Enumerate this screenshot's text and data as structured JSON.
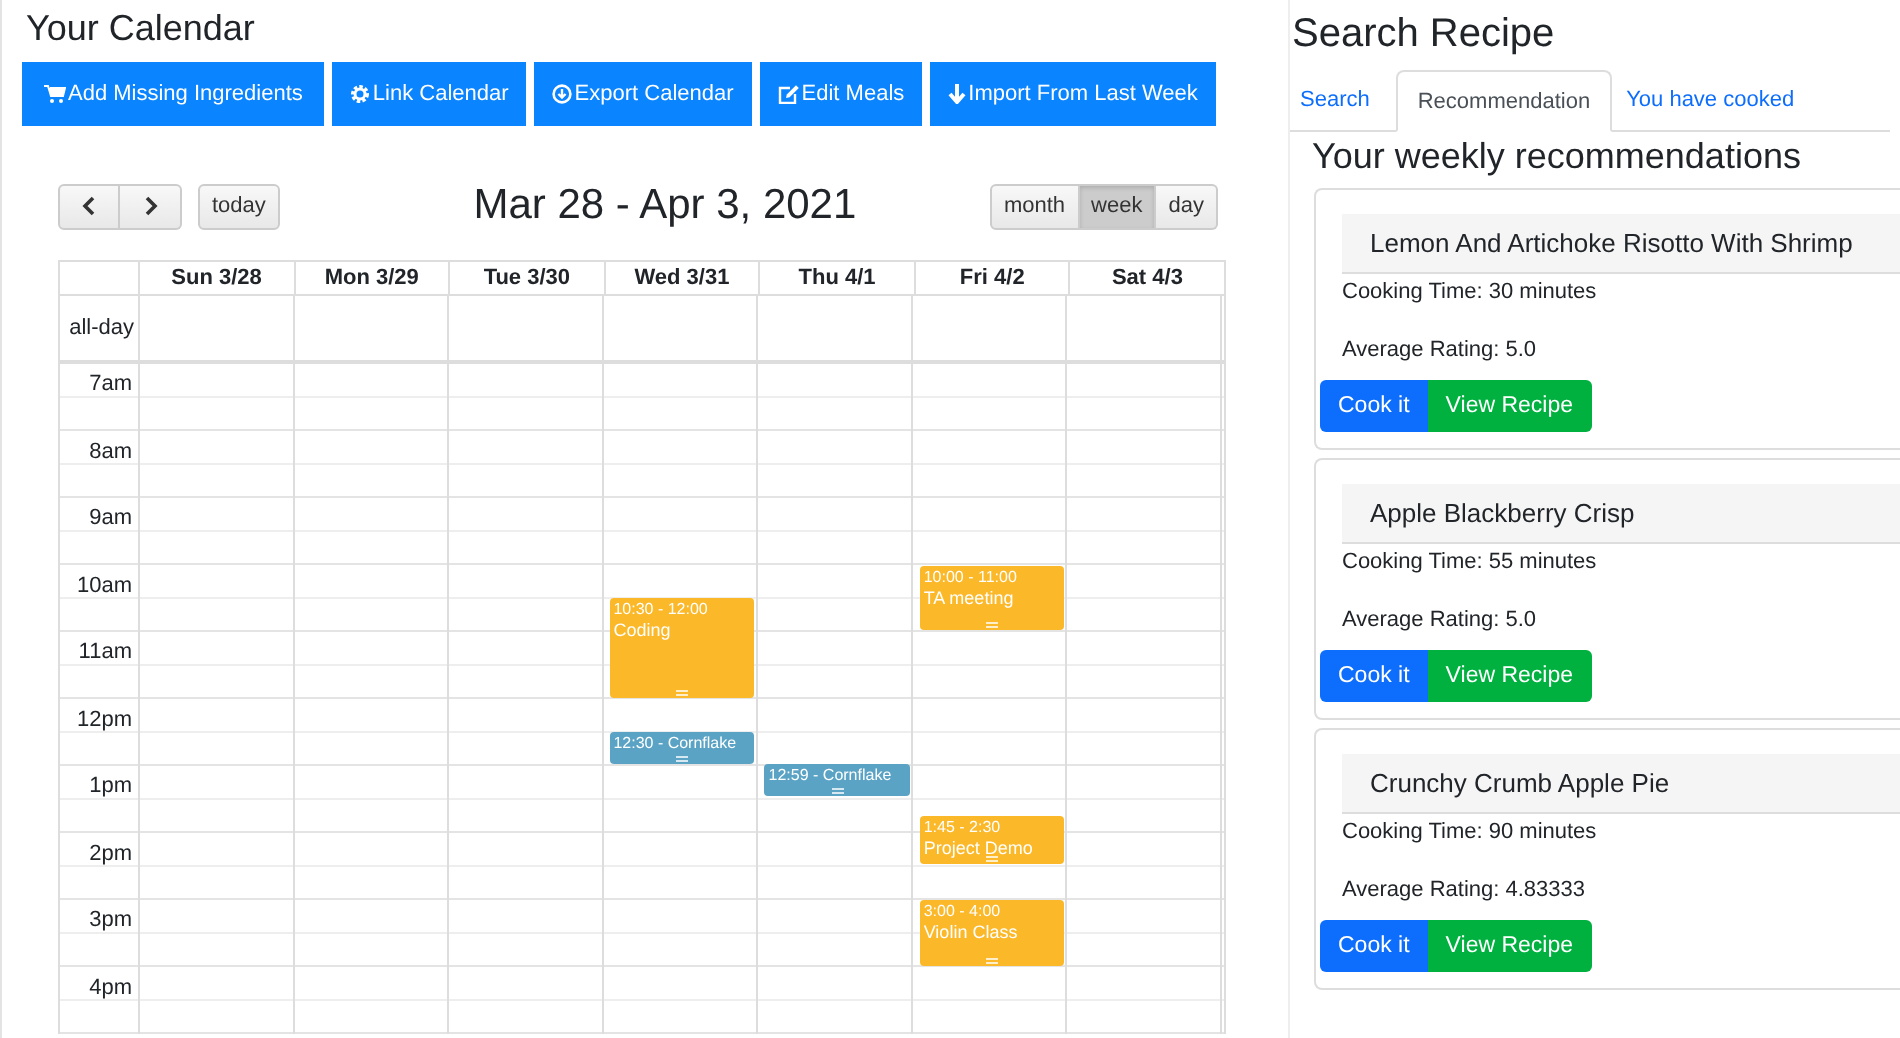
{
  "calendar": {
    "title": "Your Calendar",
    "actions": [
      "Add Missing Ingredients",
      "Link Calendar",
      "Export Calendar",
      "Edit Meals",
      "Import From Last Week"
    ],
    "today": "today",
    "range": "Mar 28 - Apr 3, 2021",
    "views": [
      {
        "label": "month",
        "selected": false
      },
      {
        "label": "week",
        "selected": true
      },
      {
        "label": "day",
        "selected": false
      }
    ],
    "all_day": "all-day",
    "columns": [
      {
        "label": "Sun 3/28"
      },
      {
        "label": "Mon 3/29"
      },
      {
        "label": "Tue 3/30"
      },
      {
        "label": "Wed 3/31",
        "events": [
          {
            "kind": "long",
            "time": "10:30 - 12:00",
            "title": "Coding",
            "color": "#fbb829"
          },
          {
            "kind": "short",
            "time": "12:30 - Cornflake",
            "color": "#5ba3c4"
          }
        ]
      },
      {
        "label": "Thu 4/1",
        "events": [
          {
            "kind": "short",
            "time": "12:59 - Cornflake",
            "color": "#5ba3c4"
          }
        ]
      },
      {
        "label": "Fri 4/2",
        "events": [
          {
            "kind": "long",
            "time": "10:00 - 11:00",
            "title": "TA meeting",
            "color": "#fbb829"
          },
          {
            "kind": "long",
            "time": "1:45 - 2:30",
            "title": "Project Demo",
            "color": "#fbb829"
          },
          {
            "kind": "long",
            "time": "3:00 - 4:00",
            "title": "Violin Class",
            "color": "#fbb829"
          }
        ]
      },
      {
        "label": "Sat 4/3"
      }
    ],
    "hours": [
      "7am",
      "8am",
      "9am",
      "10am",
      "11am",
      "12pm",
      "1pm",
      "2pm",
      "3pm",
      "4pm"
    ]
  },
  "recipes": {
    "title": "Search Recipe",
    "tabs": [
      {
        "label": "Search",
        "selected": false
      },
      {
        "label": "Recommendation",
        "selected": true
      },
      {
        "label": "You have cooked",
        "selected": false
      }
    ],
    "heading": "Your weekly recommendations",
    "cards": [
      {
        "name": "Lemon And Artichoke Risotto With Shrimp",
        "time": "Cooking Time: 30 minutes",
        "rating": "Average Rating: 5.0",
        "cook": "Cook it",
        "view": "View Recipe"
      },
      {
        "name": "Apple Blackberry Crisp",
        "time": "Cooking Time: 55 minutes",
        "rating": "Average Rating: 5.0",
        "cook": "Cook it",
        "view": "View Recipe"
      },
      {
        "name": "Crunchy Crumb Apple Pie",
        "time": "Cooking Time: 90 minutes",
        "rating": "Average Rating: 4.83333",
        "cook": "Cook it",
        "view": "View Recipe"
      }
    ]
  }
}
